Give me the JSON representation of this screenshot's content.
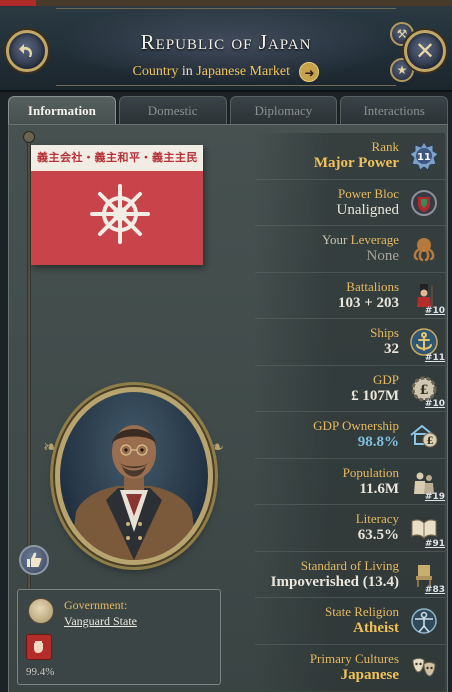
{
  "header": {
    "title": "Republic of Japan",
    "subtitle_prefix": "Country",
    "subtitle_in": "in",
    "market": "Japanese Market"
  },
  "tabs": [
    {
      "label": "Information",
      "active": true
    },
    {
      "label": "Domestic",
      "active": false
    },
    {
      "label": "Diplomacy",
      "active": false
    },
    {
      "label": "Interactions",
      "active": false
    }
  ],
  "flag": {
    "banner_text": "義主会社・義主和平・義主主民",
    "colors": {
      "field": "#c8444a",
      "band": "#f1ece4"
    }
  },
  "government": {
    "label": "Government:",
    "value": "Vanguard State",
    "lobby_percent": "99.4%"
  },
  "stats": {
    "rank": {
      "label": "Rank",
      "value": "Major Power",
      "badge": "11",
      "icon": "rank-badge-icon"
    },
    "power_bloc": {
      "label": "Power Bloc",
      "value": "Unaligned",
      "icon": "power-bloc-shield-icon"
    },
    "leverage": {
      "label_pre": "Your ",
      "label_hl": "Leverage",
      "value": "None",
      "icon": "octopus-icon"
    },
    "battalions": {
      "label": "Battalions",
      "value": "103 + 203",
      "rank": "#10",
      "icon": "soldier-icon"
    },
    "ships": {
      "label": "Ships",
      "value": "32",
      "rank": "#11",
      "icon": "anchor-icon"
    },
    "gdp": {
      "label": "GDP",
      "value": "£ 107M",
      "rank": "#10",
      "icon": "gdp-gear-icon"
    },
    "gdp_ownership": {
      "label": "GDP Ownership",
      "value": "98.8%",
      "icon": "ownership-house-icon"
    },
    "population": {
      "label": "Population",
      "value": "11.6M",
      "rank": "#19",
      "icon": "population-icon"
    },
    "literacy": {
      "label": "Literacy",
      "value": "63.5%",
      "rank": "#91",
      "icon": "book-icon"
    },
    "standard_of_living": {
      "label": "Standard of Living",
      "value": "Impoverished (13.4)",
      "rank": "#83",
      "icon": "chair-icon"
    },
    "state_religion": {
      "label": "State Religion",
      "value": "Atheist",
      "icon": "vitruvian-icon"
    },
    "primary_cultures": {
      "label": "Primary Cultures",
      "value": "Japanese",
      "icon": "masks-icon"
    }
  }
}
